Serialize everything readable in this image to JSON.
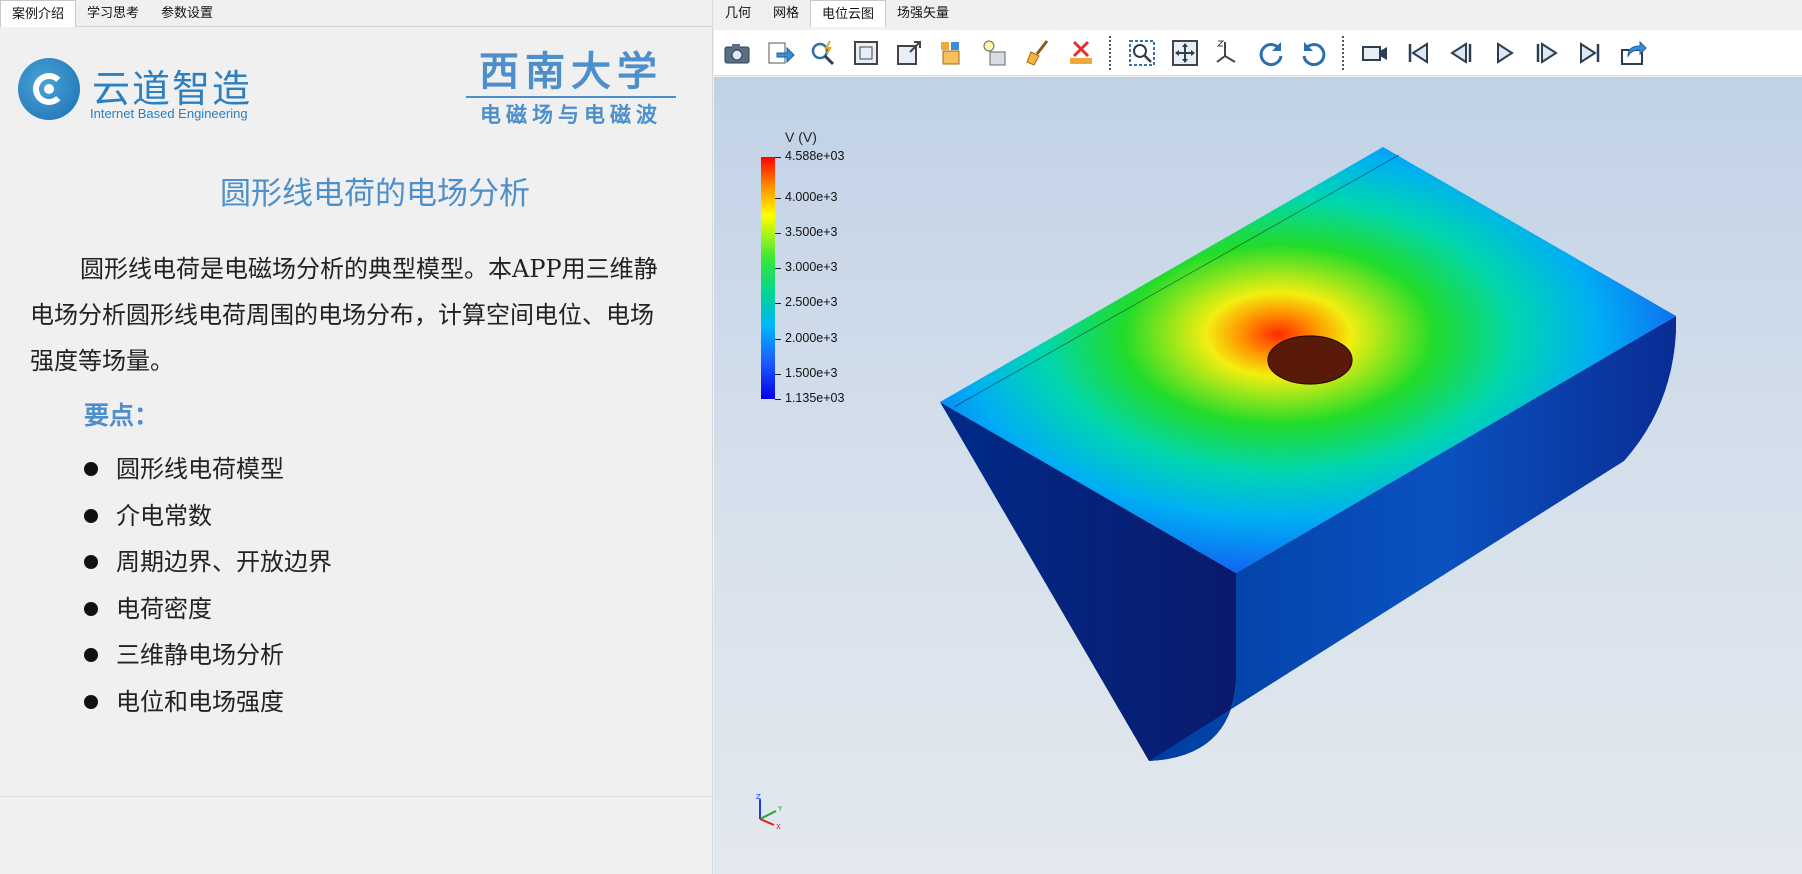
{
  "left_tabs": [
    "案例介绍",
    "学习思考",
    "参数设置"
  ],
  "logo_yun": {
    "cn": "云道智造",
    "en": "Internet Based Engineering"
  },
  "logo_xn": {
    "name": "西南大学",
    "course": "电磁场与电磁波"
  },
  "title": "圆形线电荷的电场分析",
  "intro": "圆形线电荷是电磁场分析的典型模型。本APP用三维静电场分析圆形线电荷周围的电场分布，计算空间电位、电场强度等场量。",
  "points_heading": "要点：",
  "points": [
    "圆形线电荷模型",
    "介电常数",
    "周期边界、开放边界",
    "电荷密度",
    "三维静电场分析",
    "电位和电场强度"
  ],
  "right_tabs": [
    "几何",
    "网格",
    "电位云图",
    "场强矢量"
  ],
  "active_right_tab": "电位云图",
  "toolbar_icons": [
    "camera-icon",
    "export-icon",
    "probe-icon",
    "fit-icon",
    "zoom-box-icon",
    "show-parts-icon",
    "light-icon",
    "clean-icon",
    "delete-icon",
    "select-zoom-icon",
    "pan-icon",
    "axes-icon",
    "rotate-cw-icon",
    "rotate-ccw-icon",
    "video-icon",
    "first-frame-icon",
    "prev-frame-icon",
    "play-icon",
    "next-frame-icon",
    "last-frame-icon",
    "share-icon"
  ],
  "colorbar": {
    "title": "V (V)",
    "labels": [
      "4.588e+03",
      "4.000e+3",
      "3.500e+3",
      "3.000e+3",
      "2.500e+3",
      "2.000e+3",
      "1.500e+3",
      "1.135e+03"
    ]
  },
  "axis_labels": {
    "x": "X",
    "y": "Y",
    "z": "Z"
  }
}
